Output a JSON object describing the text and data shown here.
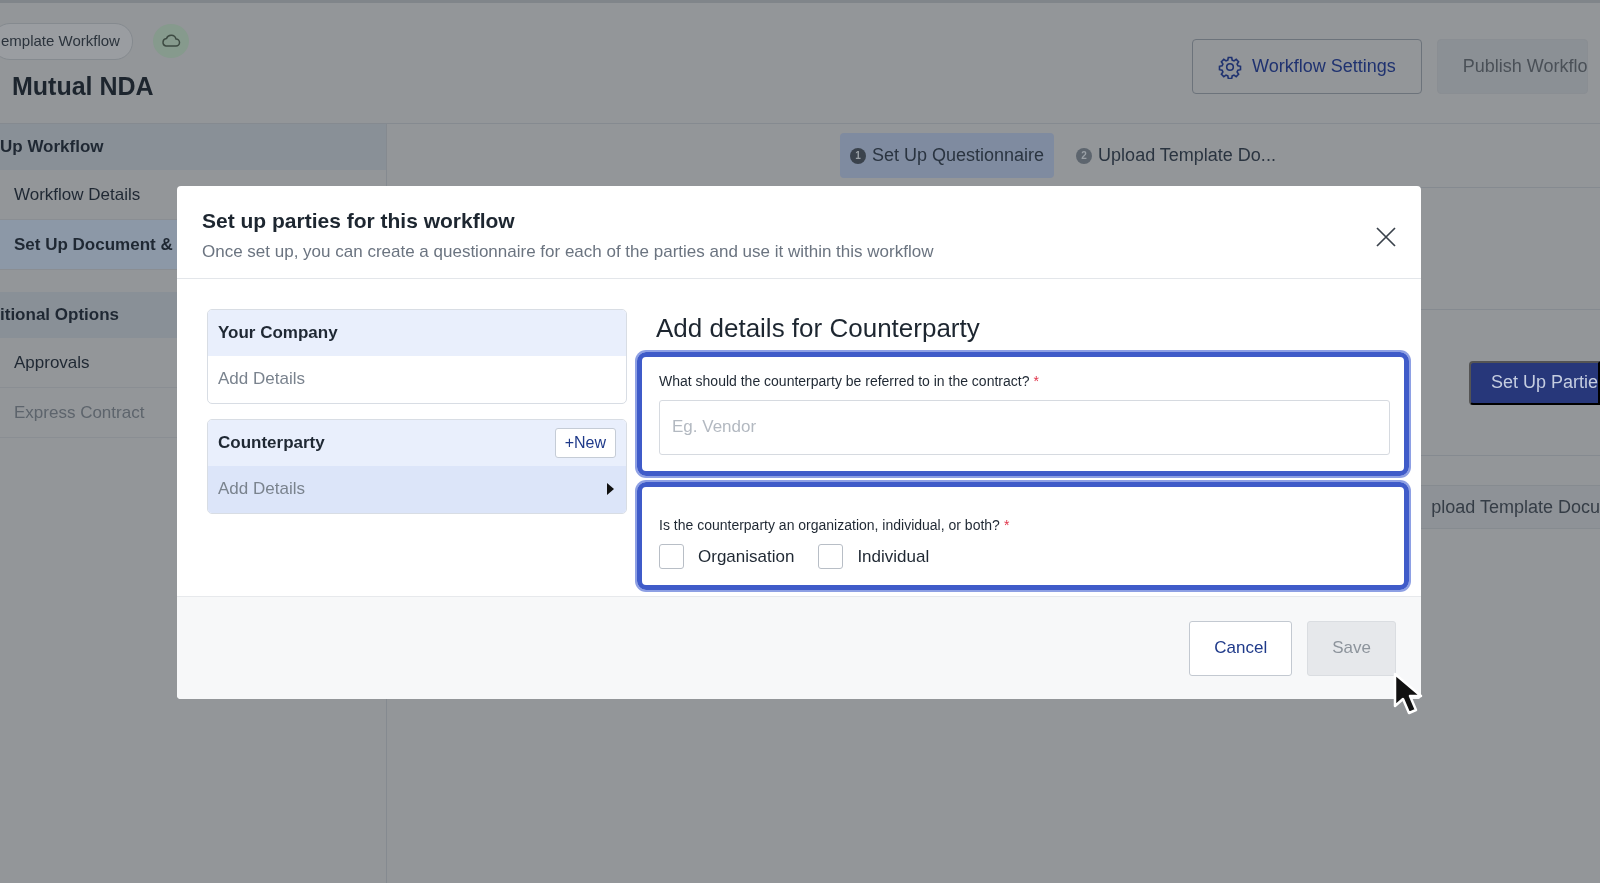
{
  "page": {
    "breadcrumb": "emplate Workflow",
    "title": "Mutual NDA",
    "header_buttons": [
      {
        "label": "Workflow Settings",
        "kind": "settings"
      },
      {
        "label": "Publish Workflo",
        "kind": "disabled"
      }
    ]
  },
  "sidebar": {
    "sections": [
      {
        "heading": "Up Workflow",
        "items": [
          {
            "label": "Workflow Details",
            "selected": false,
            "disabled": false
          },
          {
            "label": "Set Up Document &",
            "selected": true,
            "disabled": false
          }
        ]
      },
      {
        "heading": "itional Options",
        "items": [
          {
            "label": "Approvals",
            "selected": false,
            "disabled": false
          },
          {
            "label": "Express Contract",
            "selected": false,
            "disabled": true
          }
        ]
      }
    ]
  },
  "steps": [
    {
      "number": "1",
      "label": "Set Up Questionnaire",
      "selected": true
    },
    {
      "number": "2",
      "label": "Upload Template Do...",
      "selected": false
    }
  ],
  "background_actions": [
    {
      "label": "Set Up Partie",
      "kind": "primary"
    },
    {
      "label": "pload Template Docu",
      "kind": "secondary"
    }
  ],
  "modal": {
    "title": "Set up parties for this workflow",
    "subtitle": "Once set up, you can create a questionnaire for each of the parties and use it within this workflow",
    "parties": [
      {
        "name": "Your Company",
        "detail": "Add Details",
        "selected": false
      },
      {
        "name": "Counterparty",
        "action": "+New",
        "detail": "Add Details",
        "selected": true
      }
    ],
    "heading": "Add details for Counterparty",
    "questions": [
      {
        "kind": "text",
        "label": "What should the counterparty be referred to in the contract?",
        "required_mark": "*",
        "placeholder": "Eg. Vendor",
        "highlighted": true
      },
      {
        "kind": "checkboxes",
        "label": "Is the counterparty an organization, individual, or both?",
        "required_mark": "*",
        "highlighted": true,
        "options": [
          {
            "label": "Organisation",
            "checked": false
          },
          {
            "label": "Individual",
            "checked": false
          }
        ]
      }
    ],
    "buttons": [
      {
        "label": "Cancel",
        "disabled": false
      },
      {
        "label": "Save",
        "disabled": true
      }
    ]
  }
}
